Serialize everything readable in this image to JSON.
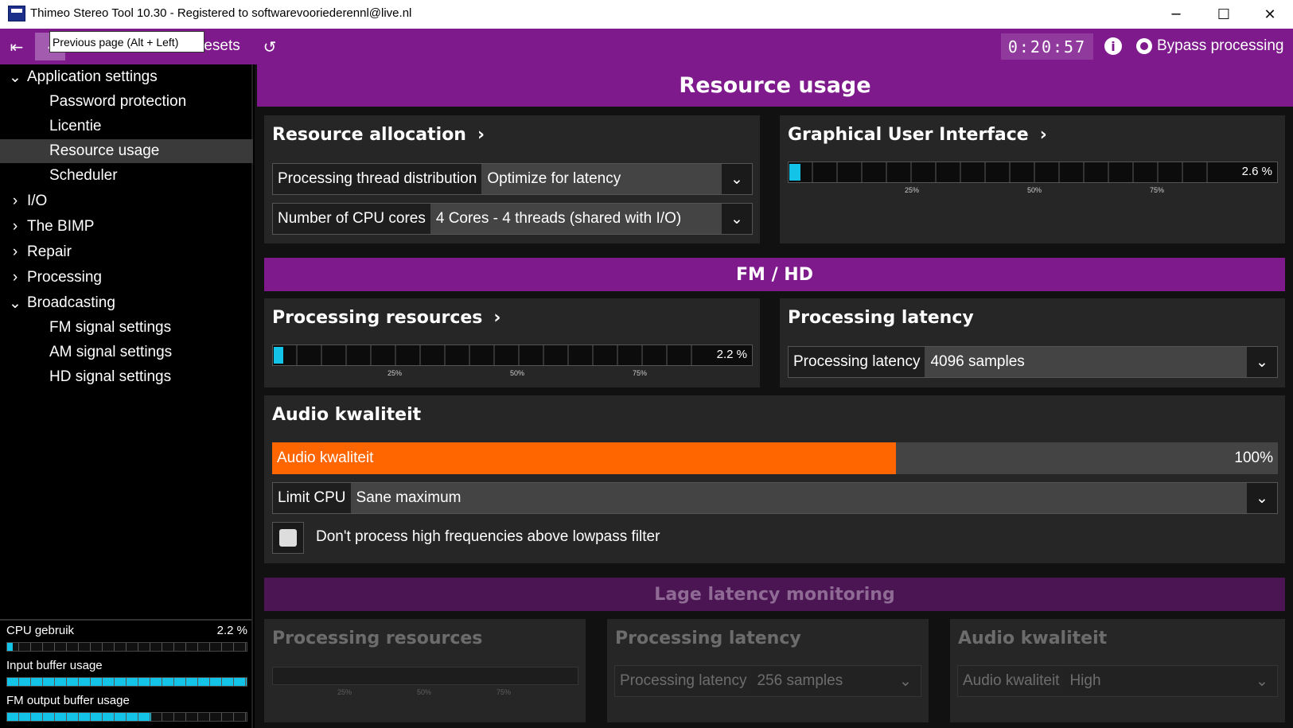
{
  "window": {
    "title": "Thimeo Stereo Tool 10.30 - Registered to softwarevooriederennl@live.nl",
    "minimize": "─",
    "maximize": "☐",
    "close": "✕"
  },
  "toolbar": {
    "first_page_icon": "⇤",
    "back_icon": "‹",
    "presets_label": "resets",
    "undo_icon": "↺",
    "clock": "0:20:57",
    "info_icon": "i",
    "bypass_label": "Bypass processing",
    "tooltip": "Previous page (Alt + Left)"
  },
  "sidebar": {
    "items": [
      {
        "label": "Application settings",
        "chevron": "⌄"
      },
      {
        "label": "Password protection"
      },
      {
        "label": "Licentie"
      },
      {
        "label": "Resource usage"
      },
      {
        "label": "Scheduler"
      },
      {
        "label": "I/O",
        "chevron": "›"
      },
      {
        "label": "The BIMP",
        "chevron": "›"
      },
      {
        "label": "Repair",
        "chevron": "›"
      },
      {
        "label": "Processing",
        "chevron": "›"
      },
      {
        "label": "Broadcasting",
        "chevron": "⌄"
      },
      {
        "label": "FM signal settings"
      },
      {
        "label": "AM signal settings"
      },
      {
        "label": "HD signal settings"
      }
    ],
    "meters": [
      {
        "label": "CPU gebruik",
        "value": "2.2 %",
        "fill": 0.022
      },
      {
        "label": "Input buffer usage",
        "value": "",
        "fill": 1.0
      },
      {
        "label": "FM output buffer usage",
        "value": "",
        "fill": 0.6
      }
    ]
  },
  "main": {
    "page_title": "Resource usage",
    "resource_allocation": {
      "title": "Resource allocation",
      "chevron": "›",
      "thread_label": "Processing thread distribution",
      "thread_value": "Optimize for latency",
      "cores_label": "Number of CPU cores",
      "cores_value": "4 Cores - 4 threads (shared with I/O)",
      "dropdown_icon": "⌄"
    },
    "gui": {
      "title": "Graphical User Interface",
      "chevron": "›",
      "usage_value": "2.6 %",
      "usage_fraction": 0.026,
      "scale": [
        "25%",
        "50%",
        "75%"
      ]
    },
    "fm_hd": {
      "section_title": "FM / HD",
      "resources_title": "Processing resources",
      "resources_chevron": "›",
      "usage_value": "2.2 %",
      "usage_fraction": 0.022,
      "scale": [
        "25%",
        "50%",
        "75%"
      ],
      "latency_title": "Processing latency",
      "latency_label": "Processing latency",
      "latency_value": "4096 samples"
    },
    "audio": {
      "title": "Audio kwaliteit",
      "slider_label": "Audio kwaliteit",
      "slider_value": "100%",
      "slider_fraction": 0.62,
      "limit_label": "Limit CPU",
      "limit_value": "Sane maximum",
      "checkbox_label": "Don't process high frequencies above lowpass filter"
    },
    "low_latency": {
      "section_title": "Lage latency monitoring",
      "resources_title": "Processing resources",
      "scale": [
        "25%",
        "50%",
        "75%"
      ],
      "latency_title": "Processing latency",
      "latency_label": "Processing latency",
      "latency_value": "256 samples",
      "audio_title": "Audio kwaliteit",
      "audio_label": "Audio kwaliteit",
      "audio_value": "High"
    }
  },
  "colors": {
    "accent": "#7e1a8c",
    "meter": "#13c4e8",
    "slider": "#ff6600"
  }
}
